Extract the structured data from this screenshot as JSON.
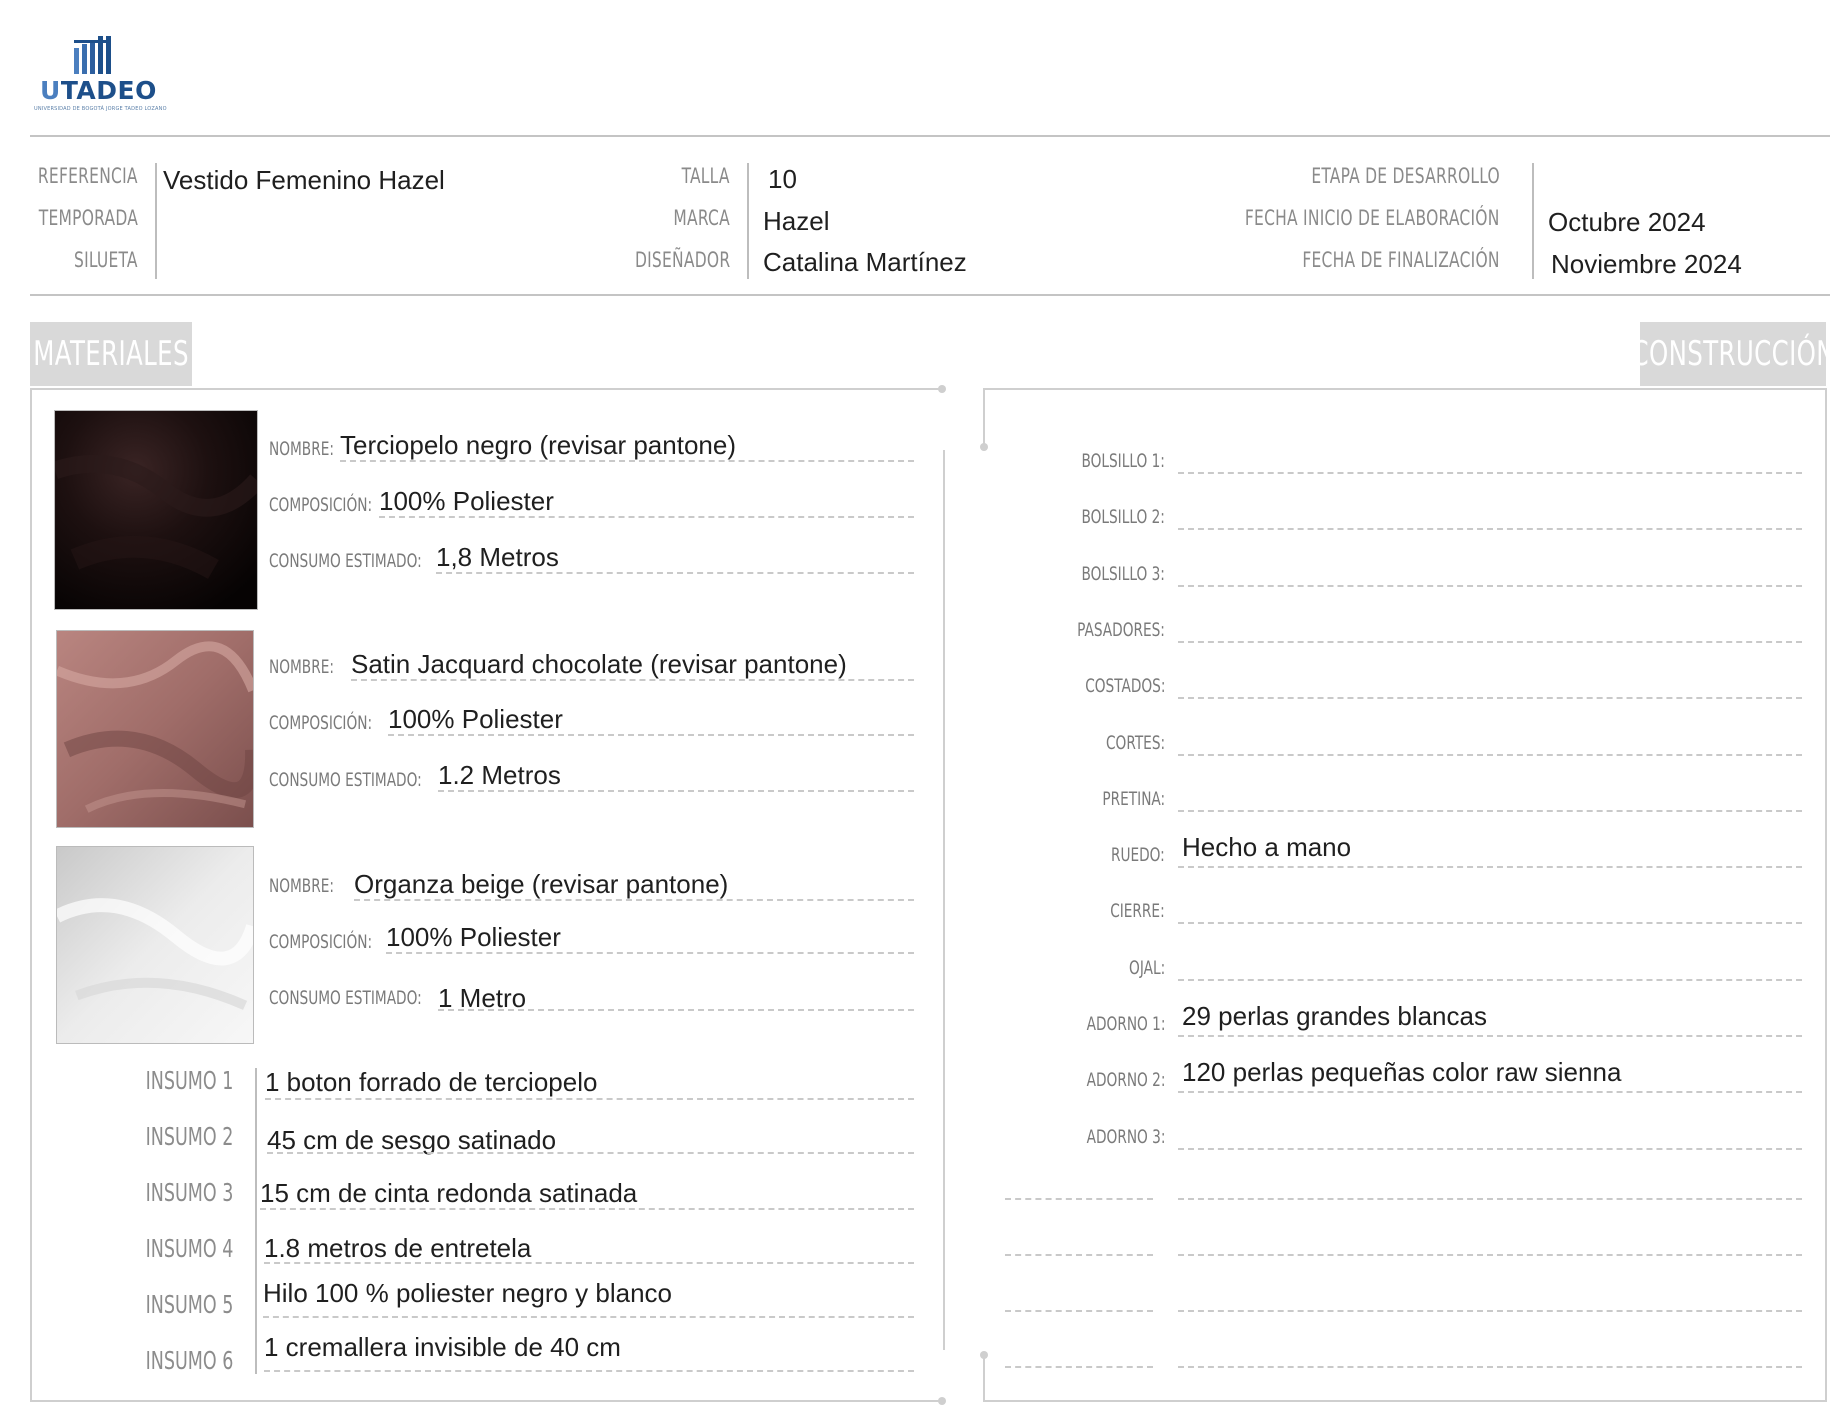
{
  "logo": {
    "word_u": "U",
    "word_rest": "TADEO",
    "subtitle": "UNIVERSIDAD DE BOGOTÁ JORGE TADEO LOZANO"
  },
  "header": {
    "referencia_label": "REFERENCIA",
    "referencia_value": "Vestido Femenino Hazel",
    "temporada_label": "TEMPORADA",
    "temporada_value": "",
    "silueta_label": "SILUETA",
    "silueta_value": "",
    "talla_label": "TALLA",
    "talla_value": "10",
    "marca_label": "MARCA",
    "marca_value": "Hazel",
    "disenador_label": "DISEÑADOR",
    "disenador_value": "Catalina Martínez",
    "etapa_label": "ETAPA DE DESARROLLO",
    "etapa_value": "",
    "fecha_inicio_label": "FECHA INICIO DE ELABORACIÓN",
    "fecha_inicio_value": "Octubre 2024",
    "fecha_fin_label": "FECHA DE FINALIZACIÓN",
    "fecha_fin_value": "Noviembre 2024"
  },
  "materiales": {
    "title": "MATERIALES",
    "items": [
      {
        "nombre_label": "NOMBRE:",
        "nombre": "Terciopelo negro (revisar pantone)",
        "composicion_label": "COMPOSICIÓN:",
        "composicion": "100% Poliester",
        "consumo_label": "CONSUMO ESTIMADO:",
        "consumo": "1,8 Metros"
      },
      {
        "nombre_label": "NOMBRE:",
        "nombre": "Satin Jacquard chocolate (revisar pantone)",
        "composicion_label": "COMPOSICIÓN:",
        "composicion": "100% Poliester",
        "consumo_label": "CONSUMO ESTIMADO:",
        "consumo": "1.2 Metros"
      },
      {
        "nombre_label": "NOMBRE:",
        "nombre": "Organza beige (revisar pantone)",
        "composicion_label": "COMPOSICIÓN:",
        "composicion": "100% Poliester",
        "consumo_label": "CONSUMO ESTIMADO:",
        "consumo": "1 Metro"
      }
    ],
    "insumos": [
      {
        "label": "INSUMO 1",
        "value": "1 boton forrado de terciopelo"
      },
      {
        "label": "INSUMO 2",
        "value": "45 cm de sesgo satinado"
      },
      {
        "label": "INSUMO 3",
        "value": "15 cm de cinta redonda satinada"
      },
      {
        "label": "INSUMO 4",
        "value": "1.8 metros de entretela"
      },
      {
        "label": "INSUMO 5",
        "value": "Hilo 100 % poliester negro y blanco"
      },
      {
        "label": "INSUMO 6",
        "value": "1 cremallera invisible de 40 cm"
      }
    ],
    "swatch_colors": [
      "#140b0b",
      "#a47470",
      "#dcdcdc"
    ]
  },
  "construccion": {
    "title": "CONSTRUCCIÓN",
    "rows": [
      {
        "label": "BOLSILLO 1:",
        "value": ""
      },
      {
        "label": "BOLSILLO 2:",
        "value": ""
      },
      {
        "label": "BOLSILLO 3:",
        "value": ""
      },
      {
        "label": "PASADORES:",
        "value": ""
      },
      {
        "label": "COSTADOS:",
        "value": ""
      },
      {
        "label": "CORTES:",
        "value": ""
      },
      {
        "label": "PRETINA:",
        "value": ""
      },
      {
        "label": "RUEDO:",
        "value": "Hecho a mano"
      },
      {
        "label": "CIERRE:",
        "value": ""
      },
      {
        "label": "OJAL:",
        "value": ""
      },
      {
        "label": "ADORNO 1:",
        "value": "29 perlas grandes blancas"
      },
      {
        "label": "ADORNO 2:",
        "value": "120 perlas pequeñas color raw sienna"
      },
      {
        "label": "ADORNO 3:",
        "value": ""
      }
    ]
  }
}
